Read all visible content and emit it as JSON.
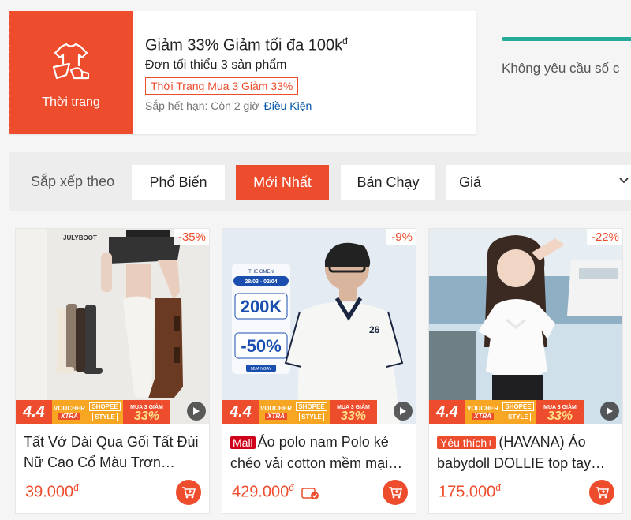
{
  "voucher": {
    "category": "Thời trang",
    "title": "Giảm 33% Giảm tối đa 100k",
    "currency": "đ",
    "min_order": "Đơn tối thiểu 3 sản phẩm",
    "tag": "Thời Trang Mua 3 Giảm 33%",
    "expiry": "Sắp hết hạn: Còn 2 giờ",
    "conditions": "Điều Kiện"
  },
  "promo": {
    "text": "Không yêu cầu số c",
    "bar_color": "#26aa99"
  },
  "sort": {
    "label": "Sắp xếp theo",
    "options": [
      "Phổ Biến",
      "Mới Nhất",
      "Bán Chạy"
    ],
    "active": "Mới Nhất",
    "price_label": "Giá"
  },
  "banner": {
    "sale": "4.4",
    "voucher": "VOUCHER",
    "xtra": "XTRA",
    "shopee": "SHOPEE",
    "style": "STYLE",
    "mua3": "MUA 3 GIẢM",
    "pct": "33%"
  },
  "products": [
    {
      "discount": "-35%",
      "title": "Tất Vớ Dài Qua Gối Tất Đùi Nữ Cao Cổ Màu Trơn Phong Cách Hàn Quốc",
      "badge": "",
      "price": "39.000",
      "currency": "đ",
      "image_brand": "JULYBOOT"
    },
    {
      "discount": "-9%",
      "title": "Áo polo nam Polo kẻ chéo vải cotton mềm mại thoáng mát",
      "badge": "Mall",
      "price": "429.000",
      "currency": "đ",
      "image_promo": {
        "dates": "28/03 - 02/04",
        "header": "THE GMEN",
        "v1": "200K",
        "v2": "-50%",
        "cta": "MUA NGAY"
      }
    },
    {
      "discount": "-22%",
      "title": "(HAVANA) Áo babydoll DOLLIE top tay bồng nữ tính",
      "badge": "Yêu thích+",
      "price": "175.000",
      "currency": "đ"
    }
  ],
  "colors": {
    "brand": "#ee4d2d",
    "link": "#0055aa",
    "mall": "#d0011b"
  }
}
